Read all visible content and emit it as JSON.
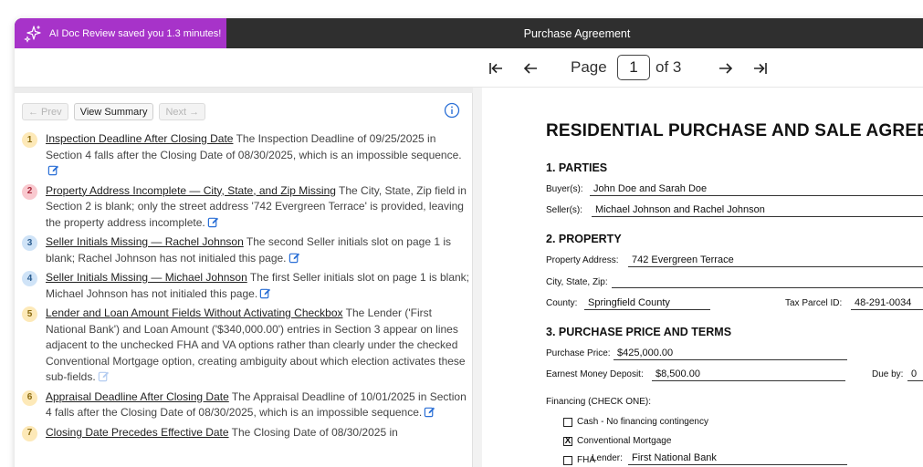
{
  "ai_banner": {
    "text": "AI Doc Review saved you 1.3 minutes!",
    "color": "#a733c9"
  },
  "document": {
    "title": "Purchase Agreement"
  },
  "pager": {
    "page_label": "Page",
    "current_page": "1",
    "of_label": "of 3"
  },
  "toolbar": {
    "prev": "← Prev",
    "view_summary": "View Summary",
    "next": "Next →"
  },
  "issues": [
    {
      "num": "1",
      "badge_bg": "#fde9b8",
      "badge_fg": "#8a6a10",
      "title": "Inspection Deadline After Closing Date",
      "text": " The Inspection Deadline of 09/25/2025 in Section 4 falls after the Closing Date of 08/30/2025, which is an impossible sequence."
    },
    {
      "num": "2",
      "badge_bg": "#f9c9cf",
      "badge_fg": "#a8283b",
      "title": "Property Address Incomplete — City, State, and Zip Missing",
      "text": " The City, State, Zip field in Section 2 is blank; only the street address '742 Evergreen Terrace' is provided, leaving the property address incomplete."
    },
    {
      "num": "3",
      "badge_bg": "#cfe3f7",
      "badge_fg": "#2a5c8f",
      "title": "Seller Initials Missing — Rachel Johnson",
      "text": " The second Seller initials slot on page 1 is blank; Rachel Johnson has not initialed this page."
    },
    {
      "num": "4",
      "badge_bg": "#cfe3f7",
      "badge_fg": "#2a5c8f",
      "title": "Seller Initials Missing — Michael Johnson",
      "text": " The first Seller initials slot on page 1 is blank; Michael Johnson has not initialed this page."
    },
    {
      "num": "5",
      "badge_bg": "#fde9b8",
      "badge_fg": "#8a6a10",
      "title": "Lender and Loan Amount Fields Without Activating Checkbox",
      "text": " The Lender ('First National Bank') and Loan Amount ('$340,000.00') entries in Section 3 appear on lines adjacent to the unchecked FHA and VA options rather than clearly under the checked Conventional Mortgage option, creating ambiguity about which election activates these sub-fields."
    },
    {
      "num": "6",
      "badge_bg": "#fde9b8",
      "badge_fg": "#8a6a10",
      "title": "Appraisal Deadline After Closing Date",
      "text": " The Appraisal Deadline of 10/01/2025 in Section 4 falls after the Closing Date of 08/30/2025, which is an impossible sequence."
    },
    {
      "num": "7",
      "badge_bg": "#fde9b8",
      "badge_fg": "#8a6a10",
      "title": "Closing Date Precedes Effective Date",
      "text": " The Closing Date of 08/30/2025 in"
    }
  ],
  "doc": {
    "heading": "RESIDENTIAL PURCHASE AND SALE AGREEM",
    "sec1": "1. PARTIES",
    "buyer_label": "Buyer(s):",
    "buyer_value": "John Doe and Sarah Doe",
    "seller_label": "Seller(s):",
    "seller_value": "Michael Johnson and Rachel Johnson",
    "sec2": "2. PROPERTY",
    "address_label": "Property Address:",
    "address_value": "742 Evergreen Terrace",
    "csz_label": "City, State, Zip:",
    "county_label": "County:",
    "county_value": "Springfield County",
    "parcel_label": "Tax Parcel ID:",
    "parcel_value": "48-291-0034",
    "sec3": "3. PURCHASE PRICE AND TERMS",
    "price_label": "Purchase Price:",
    "price_value": "$425,000.00",
    "earnest_label": "Earnest Money Deposit:",
    "earnest_value": "$8,500.00",
    "dueby_label": "Due by:",
    "dueby_value": "0",
    "financing_label": "Financing (CHECK ONE):",
    "opt_cash": "Cash - No financing contingency",
    "opt_conv": "Conventional Mortgage",
    "conv_mark": "X",
    "opt_fha": "FHA",
    "lender_label": "Lender:",
    "lender_value": "First National Bank"
  }
}
